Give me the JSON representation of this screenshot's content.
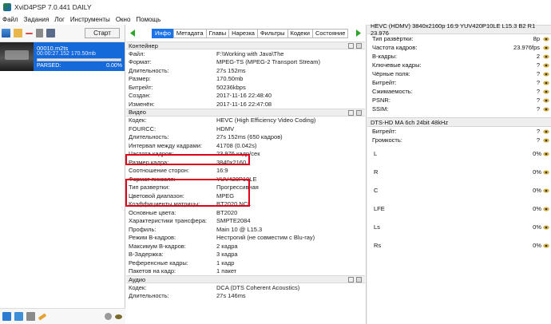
{
  "window": {
    "title": "XviD4PSP 7.0.441 DAILY"
  },
  "menu": [
    "Файл",
    "Задания",
    "Лог",
    "Инструменты",
    "Окно",
    "Помощь"
  ],
  "queue": {
    "start_label": "Старт",
    "task": {
      "file": "00010.m2ts",
      "time_size": "00:00:27.152 170.50mb",
      "status": "PARSED:",
      "progress_text": "0.00%",
      "progress": 0.0
    }
  },
  "tabs": [
    "Инфо",
    "Метадата",
    "Главы",
    "Нарезка",
    "Фильтры",
    "Кодеки",
    "Состояние"
  ],
  "active_tab": 0,
  "sections": {
    "container": {
      "title": "Контейнер",
      "rows": [
        {
          "k": "Файл:",
          "v": "F:\\Working with Java\\The"
        },
        {
          "k": "Формат:",
          "v": "MPEG-TS (MPEG-2 Transport Stream)"
        },
        {
          "k": "Длительность:",
          "v": "27s 152ms"
        },
        {
          "k": "Размер:",
          "v": "170.50mb"
        },
        {
          "k": "Битрейт:",
          "v": "50236kbps"
        },
        {
          "k": "Создан:",
          "v": "2017-11-16 22:48:40"
        },
        {
          "k": "Изменён:",
          "v": "2017-11-16 22:47:08"
        }
      ]
    },
    "video": {
      "title": "Видео",
      "rows": [
        {
          "k": "Кодек:",
          "v": "HEVC (High Efficiency Video Coding)"
        },
        {
          "k": "FOURCC:",
          "v": "HDMV"
        },
        {
          "k": "Длительность:",
          "v": "27s 152ms (650 кадров)"
        },
        {
          "k": "Интервал между кадрами:",
          "v": "41708 (0.042s)"
        },
        {
          "k": "Частота кадров:",
          "v": "23.976 кадр/сек"
        },
        {
          "k": "Размер кадра:",
          "v": "3840x2160"
        },
        {
          "k": "Соотношение сторон:",
          "v": "16:9"
        },
        {
          "k": "Формат пикселя:",
          "v": "YUV420P10LE"
        },
        {
          "k": "Тип развертки:",
          "v": "Прогрессивная"
        },
        {
          "k": "Цветовой диапазон:",
          "v": "MPEG"
        },
        {
          "k": "Коэффициенты матрицы:",
          "v": "BT2020 NCL"
        },
        {
          "k": "Основные цвета:",
          "v": "BT2020"
        },
        {
          "k": "Характеристики трансфера:",
          "v": "SMPTE2084"
        },
        {
          "k": "Профиль:",
          "v": "Main 10 @ L15.3"
        },
        {
          "k": "Режим B-кадров:",
          "v": "Нестрогий (не совместим с Blu-ray)"
        },
        {
          "k": "Максимум B-кадров:",
          "v": "2 кадра"
        },
        {
          "k": "B-Задержка:",
          "v": "3 кадра"
        },
        {
          "k": "Референсные кадры:",
          "v": "1 кадр"
        },
        {
          "k": "Пакетов на кадр:",
          "v": "1 пакет"
        }
      ]
    },
    "audio": {
      "title": "Аудио",
      "rows": [
        {
          "k": "Кодек:",
          "v": "DCA (DTS Coherent Acoustics)"
        },
        {
          "k": "Длительность:",
          "v": "27s 146ms"
        }
      ]
    }
  },
  "video_stats": {
    "header": "HEVC (HDMV) 3840x2160p 16:9 YUV420P10LE L15.3 B2 R1 23.976",
    "rows": [
      {
        "k": "Тип развёртки:",
        "v": "8p"
      },
      {
        "k": "Частота кадров:",
        "v": "23.976fps"
      },
      {
        "k": "B-кадры:",
        "v": "2"
      },
      {
        "k": "Ключевые кадры:",
        "v": "?"
      },
      {
        "k": "Чёрные поля:",
        "v": "?"
      },
      {
        "k": "Битрейт:",
        "v": "?"
      },
      {
        "k": "Сжимаемость:",
        "v": "?"
      },
      {
        "k": "PSNR:",
        "v": "?"
      },
      {
        "k": "SSIM:",
        "v": "?"
      }
    ]
  },
  "audio_stats": {
    "header": "DTS-HD MA 6ch 24bit 48kHz",
    "rows": [
      {
        "k": "Битрейт:",
        "v": "?"
      },
      {
        "k": "Громкость:",
        "v": "?"
      }
    ],
    "channels": [
      {
        "name": "L",
        "v": "0%"
      },
      {
        "name": "R",
        "v": "0%"
      },
      {
        "name": "C",
        "v": "0%"
      },
      {
        "name": "LFE",
        "v": "0%"
      },
      {
        "name": "Ls",
        "v": "0%"
      },
      {
        "name": "Rs",
        "v": "0%"
      }
    ]
  },
  "colors": {
    "accent": "#1a73e8",
    "highlight": "#e00019",
    "task_bg": "#1669d8"
  }
}
